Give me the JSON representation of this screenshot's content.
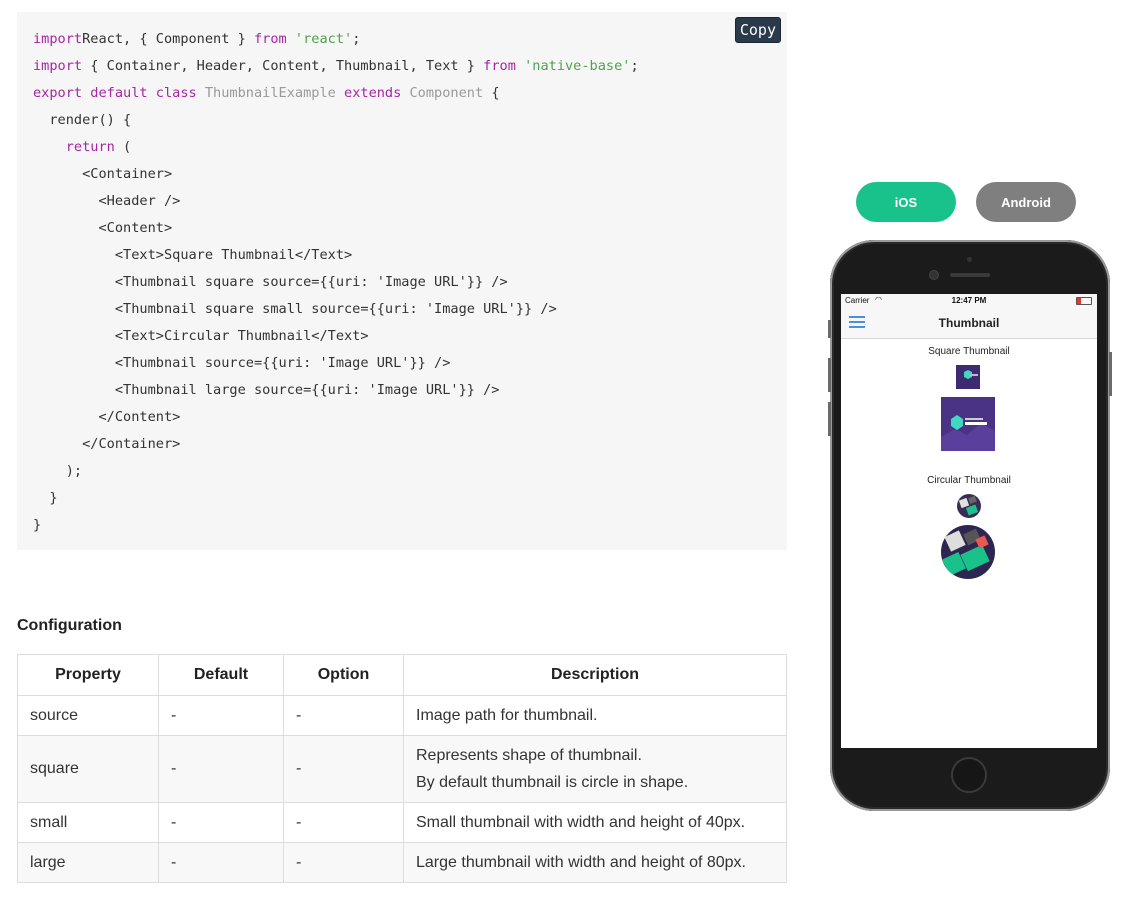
{
  "code": {
    "copy_label": "Copy",
    "lines": [
      [
        [
          "kw",
          "import"
        ],
        [
          "",
          "React, { Component } "
        ],
        [
          "kw",
          "from"
        ],
        [
          "",
          " "
        ],
        [
          "str",
          "'react'"
        ],
        [
          "",
          ";"
        ]
      ],
      [
        [
          "kw",
          "import"
        ],
        [
          "",
          " { Container, Header, Content, Thumbnail, Text } "
        ],
        [
          "kw",
          "from"
        ],
        [
          "",
          " "
        ],
        [
          "str",
          "'native-base'"
        ],
        [
          "",
          ";"
        ]
      ],
      [
        [
          "kw",
          "export default class"
        ],
        [
          "",
          " "
        ],
        [
          "cls",
          "ThumbnailExample"
        ],
        [
          "",
          " "
        ],
        [
          "kw",
          "extends"
        ],
        [
          "",
          " "
        ],
        [
          "cls",
          "Component"
        ],
        [
          "",
          " {"
        ]
      ],
      [
        [
          "",
          "  render() {"
        ]
      ],
      [
        [
          "",
          "    "
        ],
        [
          "kw",
          "return"
        ],
        [
          "",
          " ("
        ]
      ],
      [
        [
          "",
          "      <Container>"
        ]
      ],
      [
        [
          "",
          "        <Header />"
        ]
      ],
      [
        [
          "",
          "        <Content>"
        ]
      ],
      [
        [
          "",
          "          <Text>Square Thumbnail</Text>"
        ]
      ],
      [
        [
          "",
          "          <Thumbnail square source={{uri: 'Image URL'}} />"
        ]
      ],
      [
        [
          "",
          "          <Thumbnail square small source={{uri: 'Image URL'}} />"
        ]
      ],
      [
        [
          "",
          "          <Text>Circular Thumbnail</Text>"
        ]
      ],
      [
        [
          "",
          "          <Thumbnail source={{uri: 'Image URL'}} />"
        ]
      ],
      [
        [
          "",
          "          <Thumbnail large source={{uri: 'Image URL'}} />"
        ]
      ],
      [
        [
          "",
          "        </Content>"
        ]
      ],
      [
        [
          "",
          "      </Container>"
        ]
      ],
      [
        [
          "",
          "    );"
        ]
      ],
      [
        [
          "",
          "  }"
        ]
      ],
      [
        [
          "",
          "}"
        ]
      ]
    ]
  },
  "configuration": {
    "title": "Configuration",
    "headers": [
      "Property",
      "Default",
      "Option",
      "Description"
    ],
    "rows": [
      {
        "property": "source",
        "default": "-",
        "option": "-",
        "description": [
          "Image path for thumbnail."
        ]
      },
      {
        "property": "square",
        "default": "-",
        "option": "-",
        "description": [
          "Represents shape of thumbnail.",
          "By default thumbnail is circle in shape."
        ]
      },
      {
        "property": "small",
        "default": "-",
        "option": "-",
        "description": [
          "Small thumbnail with width and height of 40px."
        ]
      },
      {
        "property": "large",
        "default": "-",
        "option": "-",
        "description": [
          "Large thumbnail with width and height of 80px."
        ]
      }
    ]
  },
  "platform": {
    "ios_label": "iOS",
    "android_label": "Android",
    "active": "iOS"
  },
  "phone": {
    "carrier": "Carrier",
    "time": "12:47 PM",
    "battery_level": 0.3,
    "nav_title": "Thumbnail",
    "square_label": "Square Thumbnail",
    "circular_label": "Circular Thumbnail"
  },
  "colors": {
    "ios_button": "#19c28a",
    "android_button": "#7f7f7f",
    "code_keyword": "#a626a4",
    "code_string": "#50a14f",
    "copy_button": "#2b3a4a"
  }
}
